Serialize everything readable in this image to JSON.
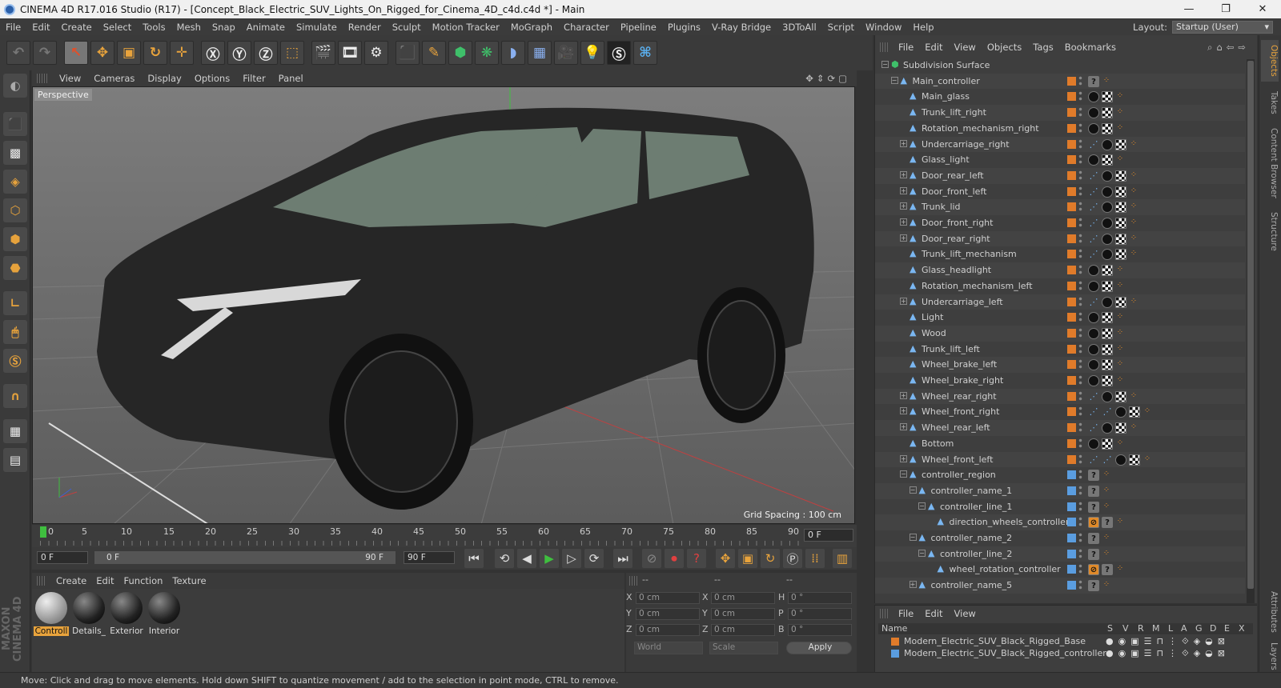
{
  "window": {
    "title": "CINEMA 4D R17.016 Studio (R17) - [Concept_Black_Electric_SUV_Lights_On_Rigged_for_Cinema_4D_c4d.c4d *] - Main",
    "controls": [
      "—",
      "❐",
      "✕"
    ]
  },
  "menu": [
    "File",
    "Edit",
    "Create",
    "Select",
    "Tools",
    "Mesh",
    "Snap",
    "Animate",
    "Simulate",
    "Render",
    "Sculpt",
    "Motion Tracker",
    "MoGraph",
    "Character",
    "Pipeline",
    "Plugins",
    "V-Ray Bridge",
    "3DToAll",
    "Script",
    "Window",
    "Help"
  ],
  "layout": {
    "label": "Layout:",
    "value": "Startup (User)"
  },
  "viewport": {
    "menu": [
      "View",
      "Cameras",
      "Display",
      "Options",
      "Filter",
      "Panel"
    ],
    "camera_label": "Perspective",
    "grid_spacing": "Grid Spacing : 100 cm"
  },
  "timeline": {
    "ticks": [
      "0",
      "5",
      "10",
      "15",
      "20",
      "25",
      "30",
      "35",
      "40",
      "45",
      "50",
      "55",
      "60",
      "65",
      "70",
      "75",
      "80",
      "85",
      "90"
    ],
    "frame_end": "0 F"
  },
  "transport": {
    "start": "0 F",
    "range_start": "0 F",
    "range_end": "90 F",
    "end": "90 F"
  },
  "materials": {
    "menu": [
      "Create",
      "Edit",
      "Function",
      "Texture"
    ],
    "items": [
      "Controll",
      "Details_",
      "Exterior",
      "Interior"
    ]
  },
  "coords": {
    "header": [
      "--",
      "--",
      "--"
    ],
    "rows": [
      {
        "a": "X",
        "av": "0 cm",
        "b": "X",
        "bv": "0 cm",
        "c": "H",
        "cv": "0 °"
      },
      {
        "a": "Y",
        "av": "0 cm",
        "b": "Y",
        "bv": "0 cm",
        "c": "P",
        "cv": "0 °"
      },
      {
        "a": "Z",
        "av": "0 cm",
        "b": "Z",
        "bv": "0 cm",
        "c": "B",
        "cv": "0 °"
      }
    ],
    "mode": "World",
    "scale": "Scale",
    "apply": "Apply"
  },
  "objects": {
    "menu": [
      "File",
      "Edit",
      "View",
      "Objects",
      "Tags",
      "Bookmarks"
    ],
    "items": [
      {
        "name": "Subdivision Surface",
        "depth": 0,
        "exp": "-",
        "icon": "subdiv"
      },
      {
        "name": "Main_controller",
        "depth": 1,
        "exp": "-",
        "icon": "null",
        "color": "orange",
        "tags": "q"
      },
      {
        "name": "Main_glass",
        "depth": 2,
        "exp": "",
        "icon": "poly",
        "color": "orange",
        "tags": "mat"
      },
      {
        "name": "Trunk_lift_right",
        "depth": 2,
        "exp": "",
        "icon": "poly",
        "color": "orange",
        "tags": "mat"
      },
      {
        "name": "Rotation_mechanism_right",
        "depth": 2,
        "exp": "",
        "icon": "poly",
        "color": "orange",
        "tags": "mat"
      },
      {
        "name": "Undercarriage_right",
        "depth": 2,
        "exp": "+",
        "icon": "poly",
        "color": "orange",
        "tags": "rigmat"
      },
      {
        "name": "Glass_light",
        "depth": 2,
        "exp": "",
        "icon": "poly",
        "color": "orange",
        "tags": "mat"
      },
      {
        "name": "Door_rear_left",
        "depth": 2,
        "exp": "+",
        "icon": "poly",
        "color": "orange",
        "tags": "rigmat"
      },
      {
        "name": "Door_front_left",
        "depth": 2,
        "exp": "+",
        "icon": "poly",
        "color": "orange",
        "tags": "rigmat"
      },
      {
        "name": "Trunk_lid",
        "depth": 2,
        "exp": "+",
        "icon": "poly",
        "color": "orange",
        "tags": "rigmat"
      },
      {
        "name": "Door_front_right",
        "depth": 2,
        "exp": "+",
        "icon": "poly",
        "color": "orange",
        "tags": "rigmat"
      },
      {
        "name": "Door_rear_right",
        "depth": 2,
        "exp": "+",
        "icon": "poly",
        "color": "orange",
        "tags": "rigmat"
      },
      {
        "name": "Trunk_lift_mechanism",
        "depth": 2,
        "exp": "",
        "icon": "poly",
        "color": "orange",
        "tags": "rigmat"
      },
      {
        "name": "Glass_headlight",
        "depth": 2,
        "exp": "",
        "icon": "poly",
        "color": "orange",
        "tags": "mat"
      },
      {
        "name": "Rotation_mechanism_left",
        "depth": 2,
        "exp": "",
        "icon": "poly",
        "color": "orange",
        "tags": "mat"
      },
      {
        "name": "Undercarriage_left",
        "depth": 2,
        "exp": "+",
        "icon": "poly",
        "color": "orange",
        "tags": "rigmat"
      },
      {
        "name": "Light",
        "depth": 2,
        "exp": "",
        "icon": "poly",
        "color": "orange",
        "tags": "mat"
      },
      {
        "name": "Wood",
        "depth": 2,
        "exp": "",
        "icon": "poly",
        "color": "orange",
        "tags": "mat"
      },
      {
        "name": "Trunk_lift_left",
        "depth": 2,
        "exp": "",
        "icon": "poly",
        "color": "orange",
        "tags": "mat"
      },
      {
        "name": "Wheel_brake_left",
        "depth": 2,
        "exp": "",
        "icon": "poly",
        "color": "orange",
        "tags": "mat"
      },
      {
        "name": "Wheel_brake_right",
        "depth": 2,
        "exp": "",
        "icon": "poly",
        "color": "orange",
        "tags": "mat"
      },
      {
        "name": "Wheel_rear_right",
        "depth": 2,
        "exp": "+",
        "icon": "poly",
        "color": "orange",
        "tags": "rigmat"
      },
      {
        "name": "Wheel_front_right",
        "depth": 2,
        "exp": "+",
        "icon": "poly",
        "color": "orange",
        "tags": "rigmat2"
      },
      {
        "name": "Wheel_rear_left",
        "depth": 2,
        "exp": "+",
        "icon": "poly",
        "color": "orange",
        "tags": "rigmat"
      },
      {
        "name": "Bottom",
        "depth": 2,
        "exp": "",
        "icon": "poly",
        "color": "orange",
        "tags": "mat"
      },
      {
        "name": "Wheel_front_left",
        "depth": 2,
        "exp": "+",
        "icon": "poly",
        "color": "orange",
        "tags": "rigmat2"
      },
      {
        "name": "controller_region",
        "depth": 2,
        "exp": "-",
        "icon": "spline",
        "color": "blue",
        "tags": "q"
      },
      {
        "name": "controller_name_1",
        "depth": 3,
        "exp": "-",
        "icon": "spline",
        "color": "blue",
        "tags": "q"
      },
      {
        "name": "controller_line_1",
        "depth": 4,
        "exp": "-",
        "icon": "spline",
        "color": "blue",
        "tags": "q"
      },
      {
        "name": "direction_wheels_controller",
        "depth": 5,
        "exp": "",
        "icon": "spline",
        "color": "blue",
        "tags": "xq"
      },
      {
        "name": "controller_name_2",
        "depth": 3,
        "exp": "-",
        "icon": "spline",
        "color": "blue",
        "tags": "q"
      },
      {
        "name": "controller_line_2",
        "depth": 4,
        "exp": "-",
        "icon": "spline",
        "color": "blue",
        "tags": "q"
      },
      {
        "name": "wheel_rotation_controller",
        "depth": 5,
        "exp": "",
        "icon": "spline",
        "color": "blue",
        "tags": "xq"
      },
      {
        "name": "controller_name_5",
        "depth": 3,
        "exp": "+",
        "icon": "spline",
        "color": "blue",
        "tags": "q"
      }
    ]
  },
  "layers": {
    "menu": [
      "File",
      "Edit",
      "View"
    ],
    "columns": [
      "Name",
      "S",
      "V",
      "R",
      "M",
      "L",
      "A",
      "G",
      "D",
      "E",
      "X"
    ],
    "items": [
      {
        "name": "Modern_Electric_SUV_Black_Rigged_Base",
        "color": "#e07b2a"
      },
      {
        "name": "Modern_Electric_SUV_Black_Rigged_controllers",
        "color": "#5a9de0"
      }
    ]
  },
  "right_tabs": [
    "Objects",
    "Takes",
    "Content Browser",
    "Structure",
    "Attributes",
    "Layers"
  ],
  "brand": "MAXON CINEMA 4D",
  "status": "Move: Click and drag to move elements. Hold down SHIFT to quantize movement / add to the selection in point mode, CTRL to remove.",
  "colors": {
    "accent": "#e8a33c",
    "layer_orange": "#e07b2a",
    "layer_blue": "#5a9de0"
  }
}
